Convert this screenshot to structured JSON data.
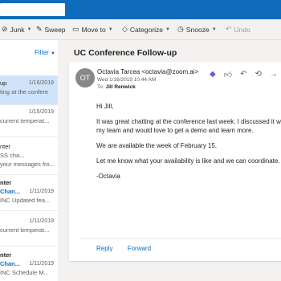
{
  "toolbar": {
    "junk": "Junk",
    "sweep": "Sweep",
    "move_to": "Move to",
    "categorize": "Categorize",
    "snooze": "Snooze",
    "undo": "Undo"
  },
  "list": {
    "filter": "Filter",
    "items": [
      {
        "line1": "up",
        "date": "1/16/2019",
        "line2": "ting at the confere"
      },
      {
        "line1": "",
        "date": "1/15/2019",
        "line2": "current temperat..."
      },
      {
        "line1": "nter",
        "date": "",
        "line2": "SS cha...",
        "line3": "your messages fro..."
      },
      {
        "line1": "nter",
        "line2": "Chan...",
        "date": "1/11/2019",
        "line3": "INC Updated fea..."
      },
      {
        "line1": "",
        "date": "1/11/2019",
        "line2": "current temperat..."
      },
      {
        "line1": "nter",
        "line2": "Chan...",
        "date": "1/11/2019",
        "line3": "INC Schedule M..."
      }
    ]
  },
  "message": {
    "subject": "UC Conference Follow-up",
    "avatar_initials": "OT",
    "sender": "Octavia Tarcea <octavia@zoom.ai>",
    "date": "Wed 1/16/2019 10:44 AM",
    "to_label": "To:",
    "to": "Jill Renwick",
    "greeting": "Hi Jill,",
    "para1_line1": "It was great chatting at the conference last week. I discussed it wi",
    "para1_line2": "my team and would love to get a demo and learn more.",
    "para2": "We are available the week of February 15.",
    "para3": "Let me know what your availability is like and we can coordinate.",
    "signoff": "-Octavia",
    "reply": "Reply",
    "forward": "Forward"
  },
  "colors": {
    "brand": "#0f6cbd",
    "selected": "#cfe4fa",
    "addin": "#7b4fd6"
  }
}
